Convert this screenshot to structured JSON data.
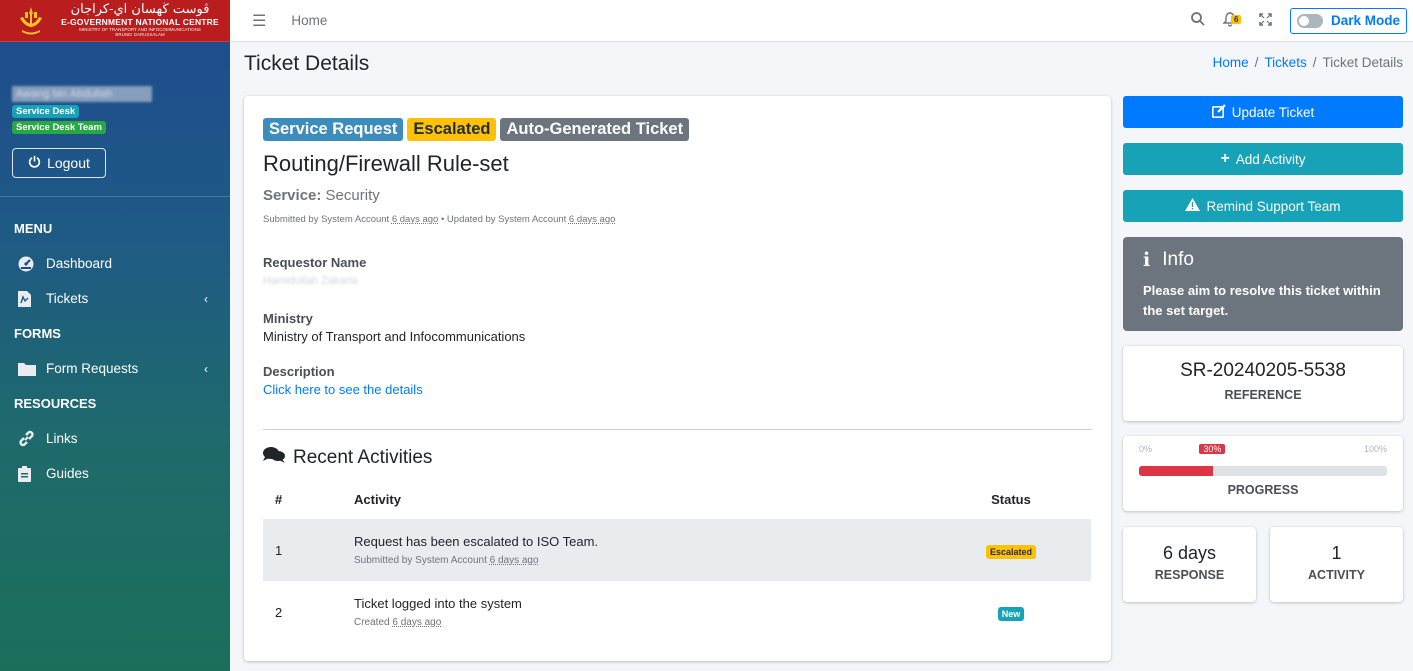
{
  "brand": {
    "arabic": "ڤوست ڬهسان اي-كراجان",
    "main": "E-GOVERNMENT NATIONAL CENTRE",
    "sub1": "MINISTRY OF TRANSPORT AND INFOCOMMUNICATIONS",
    "sub2": "BRUNEI DARUSSALAM"
  },
  "user": {
    "name": "Awang bin Abdullah",
    "role1": "Service Desk",
    "role2": "Service Desk Team",
    "logout_label": "Logout"
  },
  "sidebar": {
    "menu_header": "MENU",
    "forms_header": "FORMS",
    "resources_header": "RESOURCES",
    "items": [
      {
        "label": "Dashboard",
        "icon": "dashboard-icon"
      },
      {
        "label": "Tickets",
        "icon": "ticket-icon"
      },
      {
        "label": "Form Requests",
        "icon": "folder-icon"
      },
      {
        "label": "Links",
        "icon": "link-icon"
      },
      {
        "label": "Guides",
        "icon": "clipboard-icon"
      }
    ]
  },
  "topbar": {
    "home": "Home",
    "notif_count": "6",
    "dark_mode_label": "Dark Mode"
  },
  "page": {
    "title": "Ticket Details",
    "breadcrumb": [
      "Home",
      "Tickets",
      "Ticket Details"
    ]
  },
  "ticket": {
    "tags": [
      "Service Request",
      "Escalated",
      "Auto-Generated Ticket"
    ],
    "title": "Routing/Firewall Rule-set",
    "service_label": "Service:",
    "service_value": "Security",
    "meta": {
      "submitted_prefix": "Submitted by System Account",
      "submitted_ago": "6 days ago",
      "updated_prefix": "• Updated by System Account",
      "updated_ago": "6 days ago"
    },
    "requestor_label": "Requestor Name",
    "requestor_value": "Hamidullah Zakaria",
    "ministry_label": "Ministry",
    "ministry_value": "Ministry of Transport and Infocommunications",
    "description_label": "Description",
    "description_link": "Click here to see the details"
  },
  "activities": {
    "title": "Recent Activities",
    "columns": [
      "#",
      "Activity",
      "Status"
    ],
    "rows": [
      {
        "num": "1",
        "text": "Request has been escalated to ISO Team.",
        "sub": "Submitted by System Account",
        "ago": "6 days ago",
        "status": "Escalated"
      },
      {
        "num": "2",
        "text": "Ticket logged into the system",
        "sub": "Created",
        "ago": "6 days ago",
        "status": "New"
      }
    ]
  },
  "actions": {
    "update": "Update Ticket",
    "add_activity": "Add Activity",
    "remind": "Remind Support Team"
  },
  "info": {
    "title": "Info",
    "text": "Please aim to resolve this ticket within the set target."
  },
  "reference": {
    "value": "SR-20240205-5538",
    "label": "REFERENCE"
  },
  "progress": {
    "min": "0%",
    "max": "100%",
    "current": "30%",
    "fraction": 0.3,
    "label": "PROGRESS"
  },
  "response": {
    "value": "6 days",
    "label": "RESPONSE"
  },
  "activity_count": {
    "value": "1",
    "label": "ACTIVITY"
  },
  "colors": {
    "primary": "#007bff",
    "info": "#17a2b8",
    "warning": "#ffc107",
    "danger": "#dc3545",
    "brand_red": "#b91d1d"
  }
}
